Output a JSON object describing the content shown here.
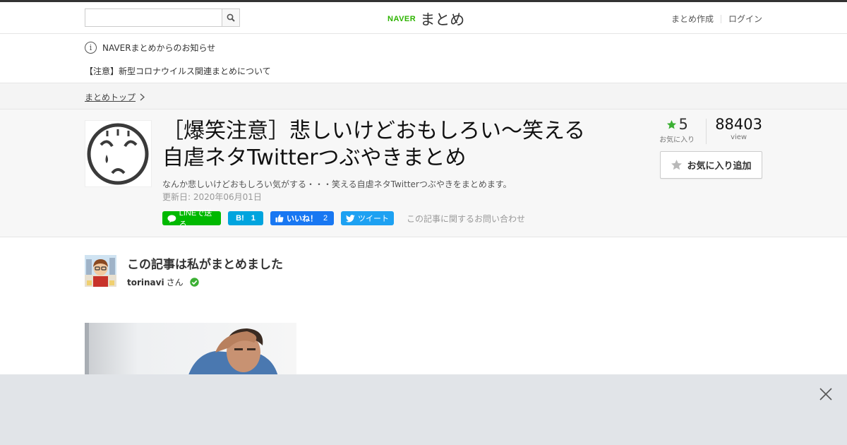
{
  "header": {
    "search_placeholder": "",
    "logo_brand": "NAVER",
    "logo_service": "まとめ",
    "links": {
      "create": "まとめ作成",
      "login": "ログイン"
    }
  },
  "notice": {
    "heading": "NAVERまとめからのお知らせ",
    "item": "【注意】新型コロナウイルス関連まとめについて"
  },
  "breadcrumb": {
    "top": "まとめトップ"
  },
  "article": {
    "title": "［爆笑注意］悲しいけどおもしろい～笑える自虐ネタTwitterつぶやきまとめ",
    "description": "なんか悲しいけどおもしろい気がする・・・笑える自虐ネタTwitterつぶやきをまとめます。",
    "updated": "更新日: 2020年06月01日",
    "share": {
      "line": "LINEで送る",
      "hatena_mark": "B!",
      "hatena_count": "1",
      "facebook": "いいね！",
      "facebook_count": "2",
      "tweet": "ツイート",
      "inquiry": "この記事に関するお問い合わせ"
    },
    "stats": {
      "favorites": "5",
      "favorites_label": "お気に入り",
      "views": "88403",
      "views_label": "view"
    },
    "favorite_button": "お気に入り追加"
  },
  "curator": {
    "heading": "この記事は私がまとめました",
    "name": "torinavi",
    "suffix": "さん"
  },
  "colors": {
    "naver_green": "#2db400",
    "line_green": "#00b900",
    "hatena_blue": "#00a4de",
    "facebook_blue": "#1877f2",
    "twitter_blue": "#1da1f2",
    "star_green": "#3cb034",
    "ad_bar": "#e1e4e8"
  },
  "icons": {
    "search": "search-icon",
    "info": "info-icon",
    "chevron": "chevron-right-icon",
    "star": "star-icon",
    "line": "line-logo-icon",
    "facebook_thumb": "thumbs-up-icon",
    "twitter": "twitter-bird-icon",
    "verified": "check-circle-icon",
    "close": "close-icon"
  }
}
